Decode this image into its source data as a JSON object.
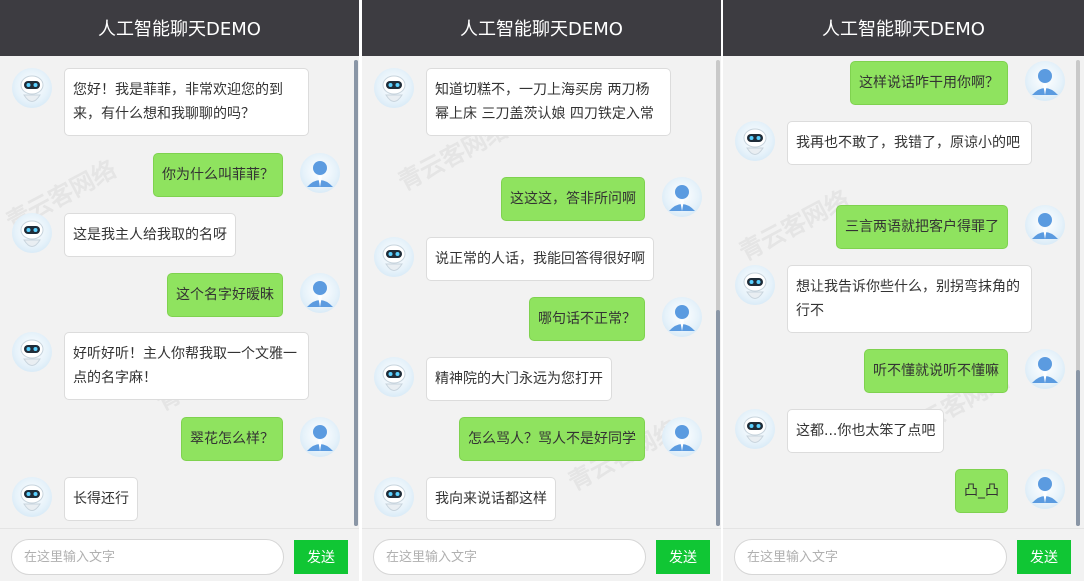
{
  "panels": [
    {
      "title": "人工智能聊天DEMO",
      "input_placeholder": "在这里输入文字",
      "send_label": "发送",
      "messages": [
        {
          "from": "bot",
          "text": "您好！我是菲菲，非常欢迎您的到来，有什么想和我聊聊的吗？"
        },
        {
          "from": "user",
          "text": "你为什么叫菲菲？"
        },
        {
          "from": "bot",
          "text": "这是我主人给我取的名呀"
        },
        {
          "from": "user",
          "text": "这个名字好暧昧"
        },
        {
          "from": "bot",
          "text": "好听好听！主人你帮我取一个文雅一点的名字麻！"
        },
        {
          "from": "user",
          "text": "翠花怎么样？"
        },
        {
          "from": "bot",
          "text": "长得还行"
        }
      ]
    },
    {
      "title": "人工智能聊天DEMO",
      "input_placeholder": "在这里输入文字",
      "send_label": "发送",
      "messages": [
        {
          "from": "bot",
          "text": "知道切糕不，一刀上海买房 两刀杨幂上床 三刀盖茨认娘 四刀铁定入常"
        },
        {
          "from": "user",
          "text": "这这这，答非所问啊"
        },
        {
          "from": "bot",
          "text": "说正常的人话，我能回答得很好啊"
        },
        {
          "from": "user",
          "text": "哪句话不正常？"
        },
        {
          "from": "bot",
          "text": "精神院的大门永远为您打开"
        },
        {
          "from": "user",
          "text": "怎么骂人？骂人不是好同学"
        },
        {
          "from": "bot",
          "text": "我向来说话都这样"
        }
      ]
    },
    {
      "title": "人工智能聊天DEMO",
      "input_placeholder": "在这里输入文字",
      "send_label": "发送",
      "messages": [
        {
          "from": "user",
          "text": "这样说话咋干用你啊？"
        },
        {
          "from": "bot",
          "text": "我再也不敢了，我错了，原谅小的吧"
        },
        {
          "from": "user",
          "text": "三言两语就把客户得罪了"
        },
        {
          "from": "bot",
          "text": "想让我告诉你些什么，别拐弯抹角的行不"
        },
        {
          "from": "user",
          "text": "听不懂就说听不懂嘛"
        },
        {
          "from": "bot",
          "text": "这都...你也太笨了点吧"
        },
        {
          "from": "user",
          "text": "凸_凸"
        }
      ]
    }
  ],
  "watermark": "青云客网络"
}
